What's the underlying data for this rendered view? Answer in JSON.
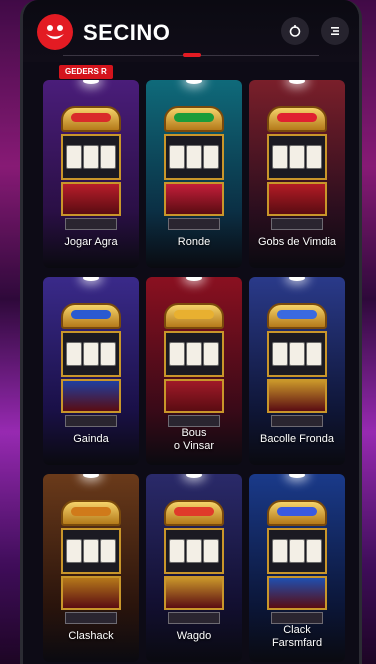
{
  "app": {
    "brand": "SECINO",
    "logo_icon": "smile-logo-icon",
    "accent": "#e31b23"
  },
  "header": {
    "icon_1": "refresh-icon",
    "icon_2": "menu-icon"
  },
  "chip": {
    "label": "GEDERS R"
  },
  "games": [
    {
      "label": "Jogar Agra",
      "bg": [
        "#4a1d7a",
        "#2a0f45"
      ],
      "sign": "#d92a2a",
      "base": "#b81d2a"
    },
    {
      "label": "Ronde",
      "bg": [
        "#0f6a7a",
        "#0b2f44"
      ],
      "sign": "#1a9c3a",
      "base": "#c41e3a"
    },
    {
      "label": "Gobs de Vimdia",
      "bg": [
        "#7a1f2a",
        "#2a0e1e"
      ],
      "sign": "#e02030",
      "base": "#b31b25"
    },
    {
      "label": "Gainda",
      "bg": [
        "#3a2a8a",
        "#1a1048"
      ],
      "sign": "#2a5ad0",
      "base": "#1f3fa0"
    },
    {
      "label": "Bous\no Vinsar",
      "bg": [
        "#8a1020",
        "#3a0a18"
      ],
      "sign": "#e8b030",
      "base": "#a01a28"
    },
    {
      "label": "Bacolle Fronda",
      "bg": [
        "#2a3a8a",
        "#0f1638"
      ],
      "sign": "#3a6ae0",
      "base": "#c9962a"
    },
    {
      "label": "Clashack",
      "bg": [
        "#6a3a1a",
        "#2a140c"
      ],
      "sign": "#d07a1a",
      "base": "#b5781a"
    },
    {
      "label": "Wagdo",
      "bg": [
        "#2a2a6a",
        "#120f30"
      ],
      "sign": "#e03a2a",
      "base": "#c9962a"
    },
    {
      "label": "Clack\nFarsmfard",
      "bg": [
        "#1a3a8a",
        "#0b1638"
      ],
      "sign": "#3a5ae0",
      "base": "#1f4fb0"
    }
  ]
}
